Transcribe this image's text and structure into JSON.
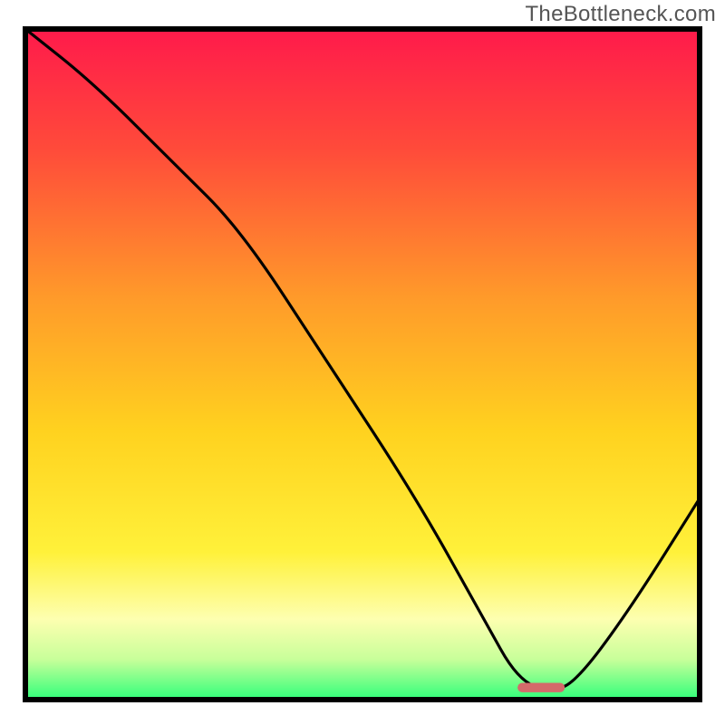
{
  "watermark": "TheBottleneck.com",
  "chart_data": {
    "type": "line",
    "title": "",
    "xlabel": "",
    "ylabel": "",
    "xlim": [
      0,
      100
    ],
    "ylim": [
      0,
      100
    ],
    "grid": false,
    "legend": false,
    "background_gradient": {
      "stops": [
        {
          "offset": 0.0,
          "color": "#ff1a4b"
        },
        {
          "offset": 0.18,
          "color": "#ff4b3a"
        },
        {
          "offset": 0.4,
          "color": "#ff9a2a"
        },
        {
          "offset": 0.6,
          "color": "#ffd21f"
        },
        {
          "offset": 0.78,
          "color": "#fff13a"
        },
        {
          "offset": 0.88,
          "color": "#fdffb0"
        },
        {
          "offset": 0.94,
          "color": "#c8ff9a"
        },
        {
          "offset": 1.0,
          "color": "#2fff7a"
        }
      ]
    },
    "series": [
      {
        "name": "bottleneck-curve",
        "color": "#000000",
        "x": [
          0,
          10,
          22,
          32,
          45,
          58,
          68,
          73,
          78,
          82,
          90,
          100
        ],
        "y": [
          100,
          92,
          80,
          70,
          50,
          30,
          12,
          3,
          1,
          3,
          14,
          30
        ]
      }
    ],
    "marker": {
      "name": "optimal-marker",
      "color": "#d46a6a",
      "x_start": 73,
      "x_end": 80,
      "y": 1.8,
      "height_pct": 1.4
    }
  }
}
